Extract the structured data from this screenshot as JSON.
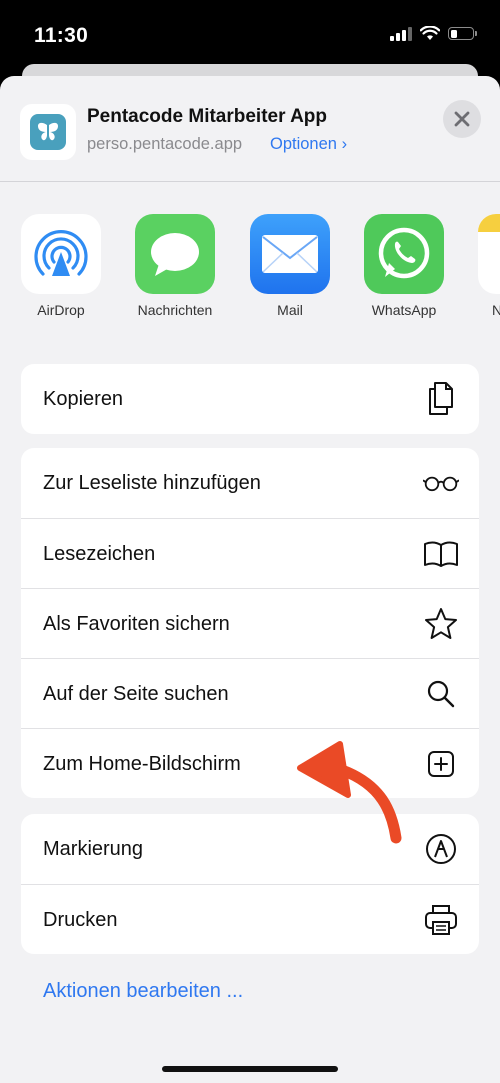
{
  "status_bar": {
    "time": "11:30"
  },
  "header": {
    "app_title": "Pentacode Mitarbeiter App",
    "url": "perso.pentacode.app",
    "options_label": "Optionen",
    "options_chevron": "›"
  },
  "share_targets": [
    {
      "label": "AirDrop",
      "icon": "airdrop-icon"
    },
    {
      "label": "Nachrichten",
      "icon": "messages-icon"
    },
    {
      "label": "Mail",
      "icon": "mail-icon"
    },
    {
      "label": "WhatsApp",
      "icon": "whatsapp-icon"
    },
    {
      "label": "N",
      "icon": "notes-icon"
    }
  ],
  "groups": [
    [
      {
        "label": "Kopieren",
        "icon": "copy-icon"
      }
    ],
    [
      {
        "label": "Zur Leseliste hinzufügen",
        "icon": "glasses-icon"
      },
      {
        "label": "Lesezeichen",
        "icon": "book-icon"
      },
      {
        "label": "Als Favoriten sichern",
        "icon": "star-icon"
      },
      {
        "label": "Auf der Seite suchen",
        "icon": "search-icon"
      },
      {
        "label": "Zum Home-Bildschirm",
        "icon": "add-square-icon"
      }
    ],
    [
      {
        "label": "Markierung",
        "icon": "markup-icon"
      },
      {
        "label": "Drucken",
        "icon": "printer-icon"
      }
    ]
  ],
  "edit_actions_label": "Aktionen bearbeiten ...",
  "colors": {
    "accent": "#2f78f0",
    "annotation_arrow": "#ea4a26",
    "whatsapp": "#4fc95a",
    "messages": "#5ad161",
    "mail": "#2f8cf3"
  }
}
